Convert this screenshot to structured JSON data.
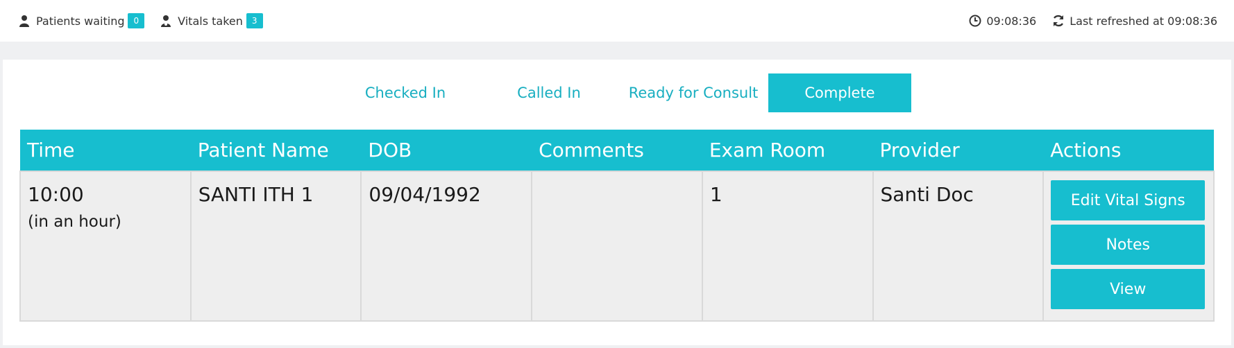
{
  "topbar": {
    "patients_waiting_label": "Patients waiting",
    "patients_waiting_count": "0",
    "vitals_taken_label": "Vitals taken",
    "vitals_taken_count": "3",
    "clock_time": "09:08:36",
    "last_refreshed": "Last refreshed at 09:08:36"
  },
  "tabs": [
    {
      "label": "Checked In",
      "active": false
    },
    {
      "label": "Called In",
      "active": false
    },
    {
      "label": "Ready for Consult",
      "active": false
    },
    {
      "label": "Complete",
      "active": true
    }
  ],
  "table": {
    "headers": [
      "Time",
      "Patient Name",
      "DOB",
      "Comments",
      "Exam Room",
      "Provider",
      "Actions"
    ],
    "rows": [
      {
        "time": "10:00",
        "time_relative": "(in an hour)",
        "patient_name": "SANTI ITH 1",
        "dob": "09/04/1992",
        "comments": "",
        "exam_room": "1",
        "provider": "Santi Doc",
        "actions": [
          "Edit Vital Signs",
          "Notes",
          "View"
        ]
      }
    ]
  },
  "colors": {
    "accent": "#17becf",
    "row_bg": "#eeeeee",
    "page_bg": "#eff0f2"
  },
  "icons": [
    "user-icon",
    "doctor-icon",
    "clock-icon",
    "refresh-icon"
  ]
}
